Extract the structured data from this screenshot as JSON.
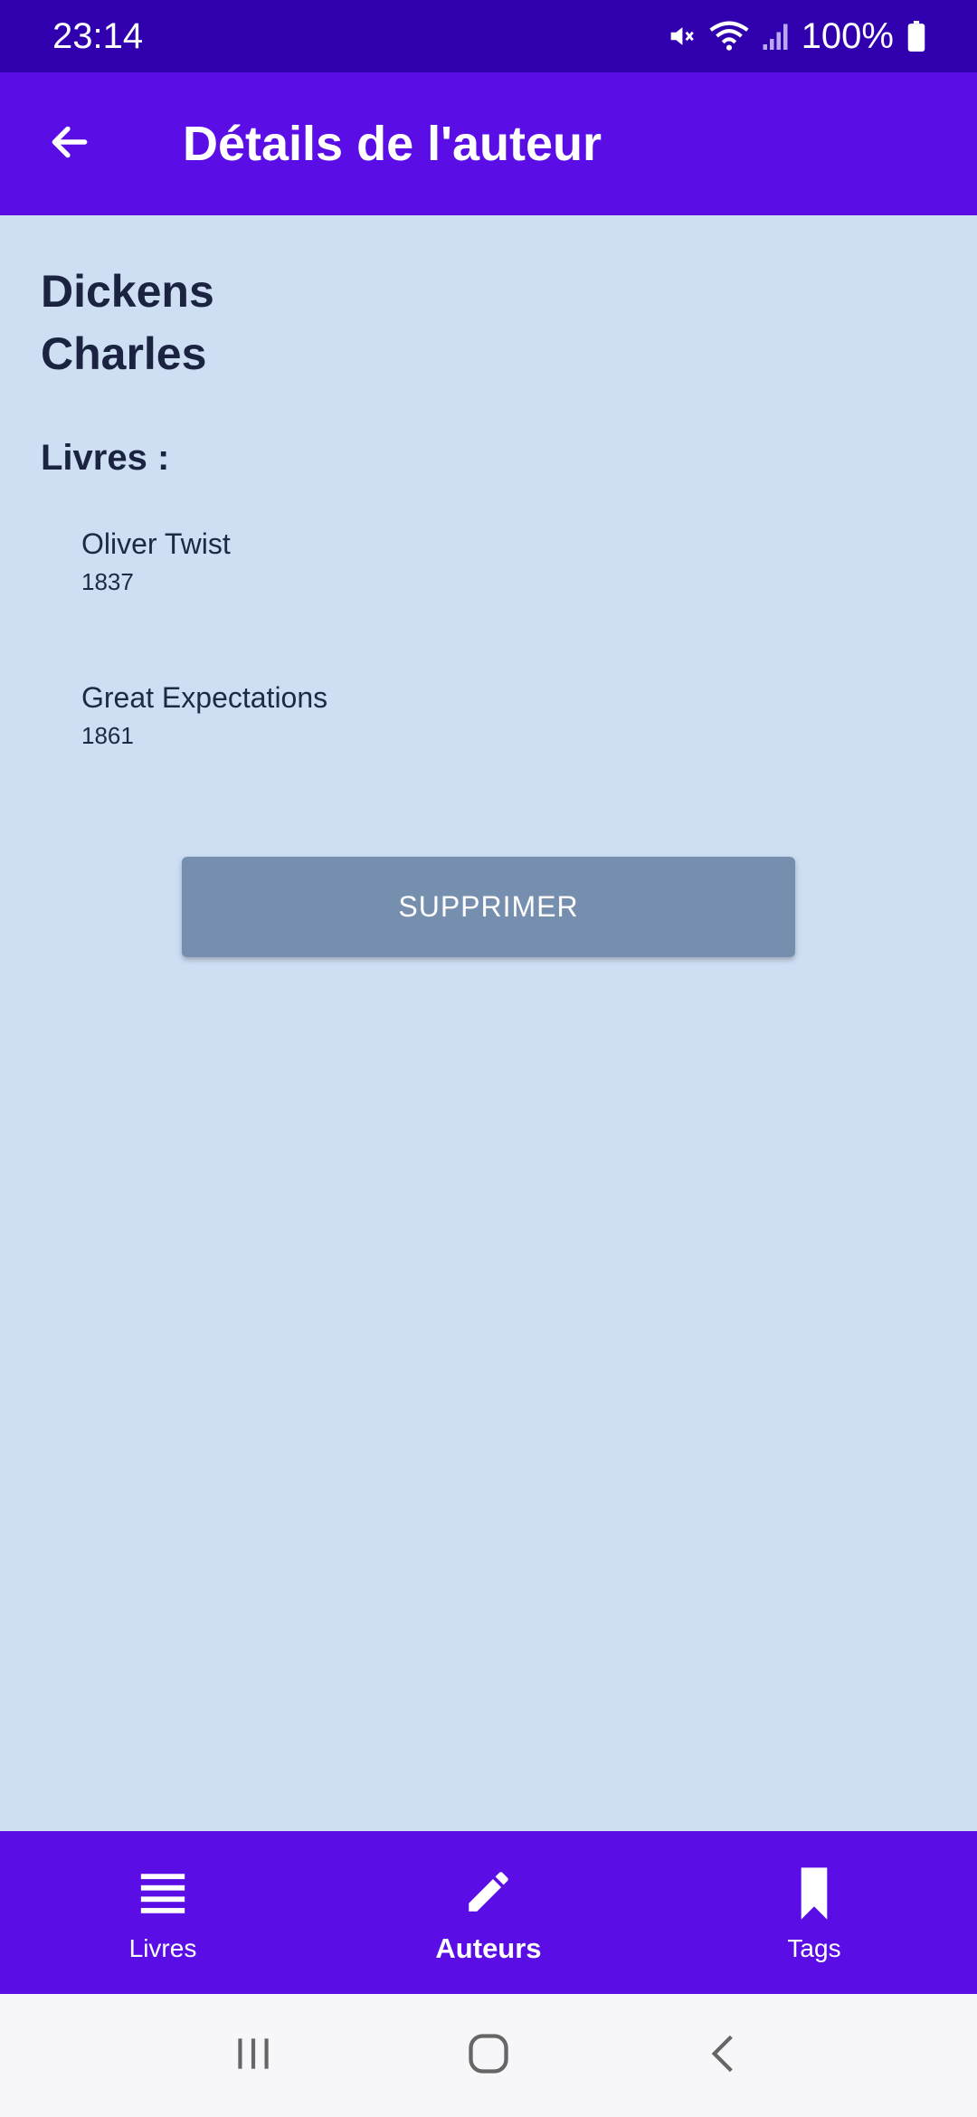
{
  "status_bar": {
    "time": "23:14",
    "battery_percent": "100%"
  },
  "app_bar": {
    "title": "Détails de l'auteur"
  },
  "author": {
    "last_name": "Dickens",
    "first_name": "Charles"
  },
  "books_heading": "Livres :",
  "books": [
    {
      "title": "Oliver Twist",
      "year": "1837"
    },
    {
      "title": "Great Expectations",
      "year": "1861"
    }
  ],
  "delete_button": {
    "label": "SUPPRIMER"
  },
  "bottom_nav": {
    "items": [
      {
        "label": "Livres",
        "icon": "list-icon",
        "active": false
      },
      {
        "label": "Auteurs",
        "icon": "pencil-icon",
        "active": true
      },
      {
        "label": "Tags",
        "icon": "bookmark-icon",
        "active": false
      }
    ]
  },
  "colors": {
    "status_bar": "#3000ae",
    "primary": "#5b0de6",
    "background": "#cedef3",
    "button": "#768faf",
    "text": "#1a2440"
  }
}
